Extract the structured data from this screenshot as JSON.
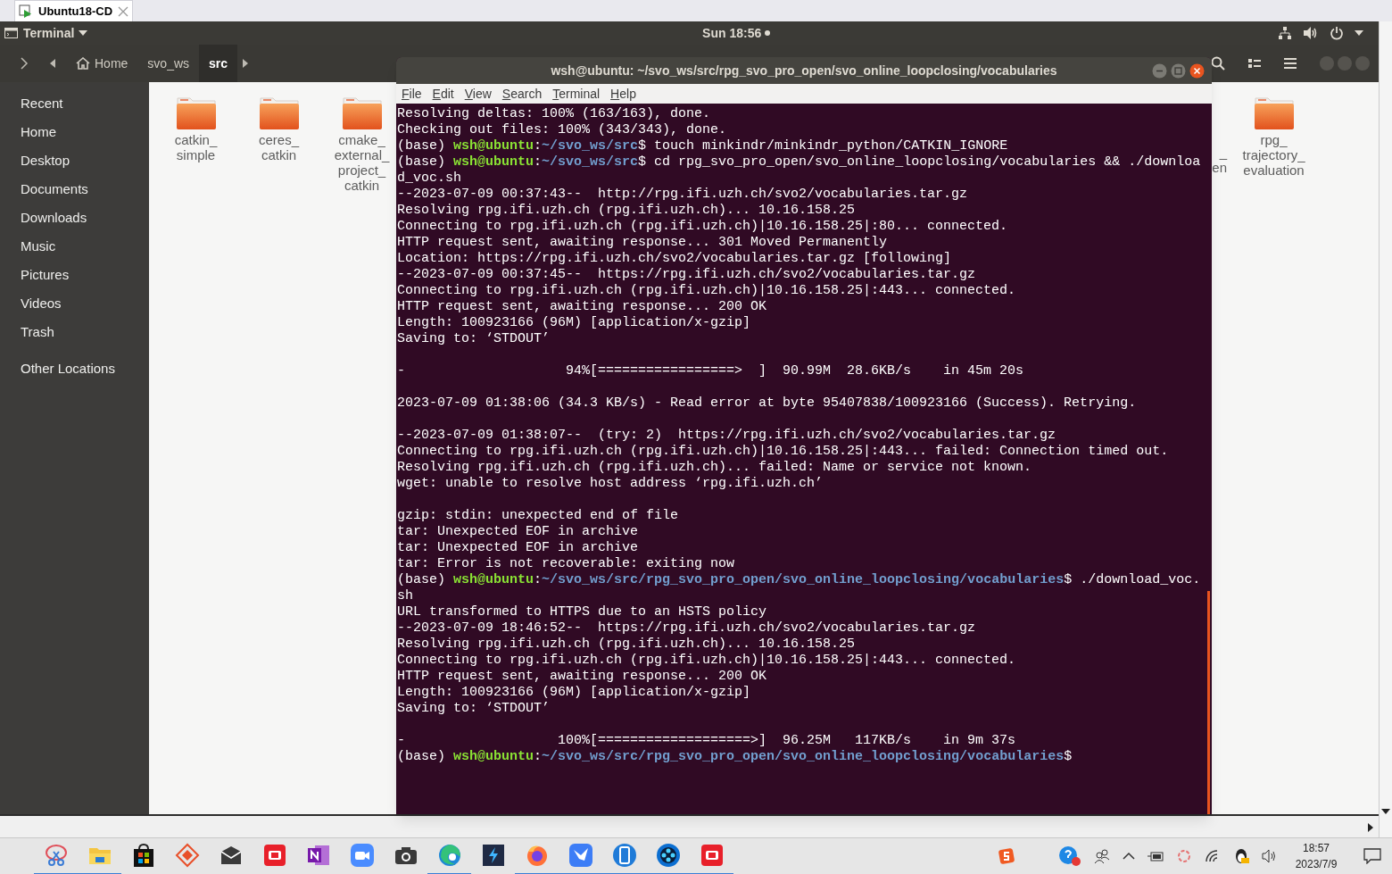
{
  "vm_tab": {
    "title": "Ubuntu18-CD"
  },
  "top_bar": {
    "app": "Terminal",
    "clock": "Sun 18:56"
  },
  "files": {
    "breadcrumbs": [
      {
        "label": "Home",
        "kind": "home",
        "selected": false
      },
      {
        "label": "svo_ws",
        "kind": "folder",
        "selected": false
      },
      {
        "label": "src",
        "kind": "folder",
        "selected": true
      }
    ],
    "sidebar": {
      "places": [
        "Recent",
        "Home",
        "Desktop",
        "Documents",
        "Downloads",
        "Music",
        "Pictures",
        "Videos",
        "Trash"
      ],
      "extra": [
        "Other Locations"
      ]
    },
    "folders_left": [
      {
        "lines": [
          "catkin_",
          "simple"
        ]
      },
      {
        "lines": [
          "ceres_",
          "catkin"
        ]
      },
      {
        "lines": [
          "cmake_",
          "external_",
          "project_",
          "catkin"
        ]
      }
    ],
    "partial_label": [
      "_",
      "en"
    ],
    "folders_right": [
      {
        "lines": [
          "rpg_",
          "trajectory_",
          "evaluation"
        ]
      }
    ]
  },
  "terminal": {
    "title": "wsh@ubuntu: ~/svo_ws/src/rpg_svo_pro_open/svo_online_loopclosing/vocabularies",
    "menu": [
      "File",
      "Edit",
      "View",
      "Search",
      "Terminal",
      "Help"
    ],
    "lines": [
      {
        "kind": "text",
        "segments": [
          {
            "kind": "plain",
            "text": "Resolving deltas: 100% (163/163), done."
          }
        ]
      },
      {
        "kind": "text",
        "segments": [
          {
            "kind": "plain",
            "text": "Checking out files: 100% (343/343), done."
          }
        ]
      },
      {
        "kind": "text",
        "segments": [
          {
            "kind": "plain",
            "text": "(base) "
          },
          {
            "kind": "user",
            "text": "wsh@ubuntu"
          },
          {
            "kind": "plain",
            "text": ":"
          },
          {
            "kind": "path",
            "text": "~/svo_ws/src"
          },
          {
            "kind": "plain",
            "text": "$ touch minkindr/minkindr_python/CATKIN_IGNORE"
          }
        ]
      },
      {
        "kind": "text",
        "segments": [
          {
            "kind": "plain",
            "text": "(base) "
          },
          {
            "kind": "user",
            "text": "wsh@ubuntu"
          },
          {
            "kind": "plain",
            "text": ":"
          },
          {
            "kind": "path",
            "text": "~/svo_ws/src"
          },
          {
            "kind": "plain",
            "text": "$ cd rpg_svo_pro_open/svo_online_loopclosing/vocabularies && ./downloa"
          }
        ]
      },
      {
        "kind": "text",
        "segments": [
          {
            "kind": "plain",
            "text": "d_voc.sh"
          }
        ]
      },
      {
        "kind": "text",
        "segments": [
          {
            "kind": "plain",
            "text": "--2023-07-09 00:37:43--  http://rpg.ifi.uzh.ch/svo2/vocabularies.tar.gz"
          }
        ]
      },
      {
        "kind": "text",
        "segments": [
          {
            "kind": "plain",
            "text": "Resolving rpg.ifi.uzh.ch (rpg.ifi.uzh.ch)... 10.16.158.25"
          }
        ]
      },
      {
        "kind": "text",
        "segments": [
          {
            "kind": "plain",
            "text": "Connecting to rpg.ifi.uzh.ch (rpg.ifi.uzh.ch)|10.16.158.25|:80... connected."
          }
        ]
      },
      {
        "kind": "text",
        "segments": [
          {
            "kind": "plain",
            "text": "HTTP request sent, awaiting response... 301 Moved Permanently"
          }
        ]
      },
      {
        "kind": "text",
        "segments": [
          {
            "kind": "plain",
            "text": "Location: https://rpg.ifi.uzh.ch/svo2/vocabularies.tar.gz [following]"
          }
        ]
      },
      {
        "kind": "text",
        "segments": [
          {
            "kind": "plain",
            "text": "--2023-07-09 00:37:45--  https://rpg.ifi.uzh.ch/svo2/vocabularies.tar.gz"
          }
        ]
      },
      {
        "kind": "text",
        "segments": [
          {
            "kind": "plain",
            "text": "Connecting to rpg.ifi.uzh.ch (rpg.ifi.uzh.ch)|10.16.158.25|:443... connected."
          }
        ]
      },
      {
        "kind": "text",
        "segments": [
          {
            "kind": "plain",
            "text": "HTTP request sent, awaiting response... 200 OK"
          }
        ]
      },
      {
        "kind": "text",
        "segments": [
          {
            "kind": "plain",
            "text": "Length: 100923166 (96M) [application/x-gzip]"
          }
        ]
      },
      {
        "kind": "text",
        "segments": [
          {
            "kind": "plain",
            "text": "Saving to: ‘STDOUT’"
          }
        ]
      },
      {
        "kind": "blank"
      },
      {
        "kind": "text",
        "segments": [
          {
            "kind": "plain",
            "text": "-                    94%[=================>  ]  90.99M  28.6KB/s    in 45m 20s"
          }
        ]
      },
      {
        "kind": "blank"
      },
      {
        "kind": "text",
        "segments": [
          {
            "kind": "plain",
            "text": "2023-07-09 01:38:06 (34.3 KB/s) - Read error at byte 95407838/100923166 (Success). Retrying."
          }
        ]
      },
      {
        "kind": "blank"
      },
      {
        "kind": "text",
        "segments": [
          {
            "kind": "plain",
            "text": "--2023-07-09 01:38:07--  (try: 2)  https://rpg.ifi.uzh.ch/svo2/vocabularies.tar.gz"
          }
        ]
      },
      {
        "kind": "text",
        "segments": [
          {
            "kind": "plain",
            "text": "Connecting to rpg.ifi.uzh.ch (rpg.ifi.uzh.ch)|10.16.158.25|:443... failed: Connection timed out."
          }
        ]
      },
      {
        "kind": "text",
        "segments": [
          {
            "kind": "plain",
            "text": "Resolving rpg.ifi.uzh.ch (rpg.ifi.uzh.ch)... failed: Name or service not known."
          }
        ]
      },
      {
        "kind": "text",
        "segments": [
          {
            "kind": "plain",
            "text": "wget: unable to resolve host address ‘rpg.ifi.uzh.ch’"
          }
        ]
      },
      {
        "kind": "blank"
      },
      {
        "kind": "text",
        "segments": [
          {
            "kind": "plain",
            "text": "gzip: stdin: unexpected end of file"
          }
        ]
      },
      {
        "kind": "text",
        "segments": [
          {
            "kind": "plain",
            "text": "tar: Unexpected EOF in archive"
          }
        ]
      },
      {
        "kind": "text",
        "segments": [
          {
            "kind": "plain",
            "text": "tar: Unexpected EOF in archive"
          }
        ]
      },
      {
        "kind": "text",
        "segments": [
          {
            "kind": "plain",
            "text": "tar: Error is not recoverable: exiting now"
          }
        ]
      },
      {
        "kind": "text",
        "segments": [
          {
            "kind": "plain",
            "text": "(base) "
          },
          {
            "kind": "user",
            "text": "wsh@ubuntu"
          },
          {
            "kind": "plain",
            "text": ":"
          },
          {
            "kind": "path",
            "text": "~/svo_ws/src/rpg_svo_pro_open/svo_online_loopclosing/vocabularies"
          },
          {
            "kind": "plain",
            "text": "$ ./download_voc."
          }
        ]
      },
      {
        "kind": "text",
        "segments": [
          {
            "kind": "plain",
            "text": "sh"
          }
        ]
      },
      {
        "kind": "text",
        "segments": [
          {
            "kind": "plain",
            "text": "URL transformed to HTTPS due to an HSTS policy"
          }
        ]
      },
      {
        "kind": "text",
        "segments": [
          {
            "kind": "plain",
            "text": "--2023-07-09 18:46:52--  https://rpg.ifi.uzh.ch/svo2/vocabularies.tar.gz"
          }
        ]
      },
      {
        "kind": "text",
        "segments": [
          {
            "kind": "plain",
            "text": "Resolving rpg.ifi.uzh.ch (rpg.ifi.uzh.ch)... 10.16.158.25"
          }
        ]
      },
      {
        "kind": "text",
        "segments": [
          {
            "kind": "plain",
            "text": "Connecting to rpg.ifi.uzh.ch (rpg.ifi.uzh.ch)|10.16.158.25|:443... connected."
          }
        ]
      },
      {
        "kind": "text",
        "segments": [
          {
            "kind": "plain",
            "text": "HTTP request sent, awaiting response... 200 OK"
          }
        ]
      },
      {
        "kind": "text",
        "segments": [
          {
            "kind": "plain",
            "text": "Length: 100923166 (96M) [application/x-gzip]"
          }
        ]
      },
      {
        "kind": "text",
        "segments": [
          {
            "kind": "plain",
            "text": "Saving to: ‘STDOUT’"
          }
        ]
      },
      {
        "kind": "blank"
      },
      {
        "kind": "text",
        "segments": [
          {
            "kind": "plain",
            "text": "-                   100%[===================>]  96.25M   117KB/s    in 9m 37s"
          }
        ]
      },
      {
        "kind": "text",
        "segments": [
          {
            "kind": "plain",
            "text": "(base) "
          },
          {
            "kind": "user",
            "text": "wsh@ubuntu"
          },
          {
            "kind": "plain",
            "text": ":"
          },
          {
            "kind": "path",
            "text": "~/svo_ws/src/rpg_svo_pro_open/svo_online_loopclosing/vocabularies"
          },
          {
            "kind": "plain",
            "text": "$"
          }
        ]
      }
    ]
  },
  "taskbar": {
    "apps": [
      {
        "kind": "snip",
        "running": true
      },
      {
        "kind": "explorer",
        "running": true
      },
      {
        "kind": "store",
        "running": false
      },
      {
        "kind": "diamond",
        "running": false
      },
      {
        "kind": "mail",
        "running": false
      },
      {
        "kind": "red",
        "running": false
      },
      {
        "kind": "notebook",
        "running": false
      },
      {
        "kind": "meeting",
        "running": false
      },
      {
        "kind": "camera",
        "running": false
      },
      {
        "kind": "edge",
        "running": true
      },
      {
        "kind": "dark",
        "running": false
      },
      {
        "kind": "firefox",
        "running": true
      },
      {
        "kind": "bird",
        "running": true
      },
      {
        "kind": "phone",
        "running": true
      },
      {
        "kind": "reel",
        "running": true
      },
      {
        "kind": "red",
        "running": true
      }
    ],
    "time": "18:57",
    "date": "2023/7/9"
  }
}
